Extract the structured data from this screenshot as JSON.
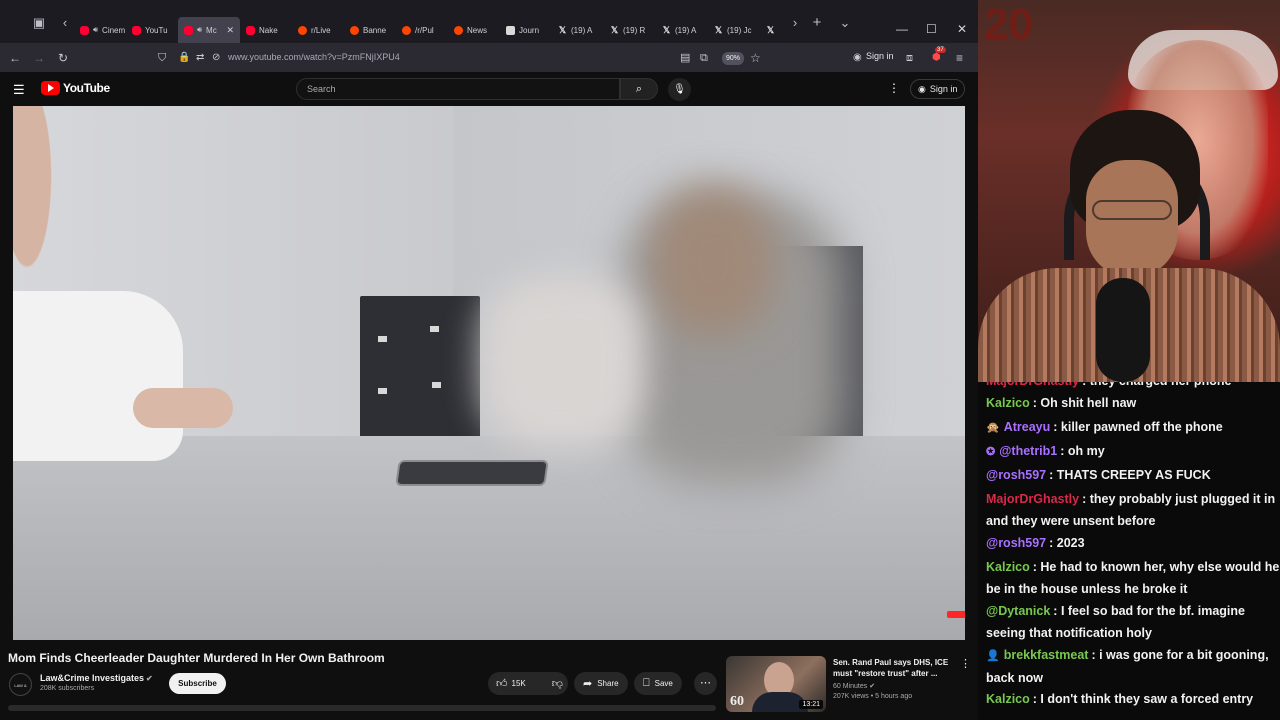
{
  "browser": {
    "tabs": [
      {
        "label": "Cinem",
        "icon": "youtube-icon",
        "audio": true
      },
      {
        "label": "YouTu",
        "icon": "youtube-icon",
        "audio": false
      },
      {
        "label": "Mc",
        "icon": "youtube-icon",
        "audio": true,
        "active": true
      },
      {
        "label": "Nake",
        "icon": "youtube-icon",
        "audio": false
      },
      {
        "label": "r/Live",
        "icon": "reddit-icon",
        "audio": false
      },
      {
        "label": "Banne",
        "icon": "reddit-icon",
        "audio": false
      },
      {
        "label": "/r/Pul",
        "icon": "reddit-icon",
        "audio": false
      },
      {
        "label": "News",
        "icon": "reddit-icon",
        "audio": false
      },
      {
        "label": "Journ",
        "icon": "ap-icon",
        "audio": false
      },
      {
        "label": "(19) A",
        "icon": "x-icon",
        "audio": false
      },
      {
        "label": "(19) R",
        "icon": "x-icon",
        "audio": false
      },
      {
        "label": "(19) A",
        "icon": "x-icon",
        "audio": false
      },
      {
        "label": "(19) Jc",
        "icon": "x-icon",
        "audio": false
      },
      {
        "label": "",
        "icon": "x-icon",
        "audio": false
      }
    ],
    "url": "www.youtube.com/watch?v=PzmFNjIXPU4",
    "zoom": "90%",
    "extension_badge": "37",
    "signin_label": "Sign in"
  },
  "youtube": {
    "logo_text": "YouTube",
    "search_placeholder": "Search",
    "signin_label": "Sign in",
    "video": {
      "title": "Mom Finds Cheerleader Daughter Murdered In Her Own Bathroom",
      "channel": "Law&Crime Investigates",
      "channel_avatar_text": "LAW & CRIME",
      "subscribers": "208K subscribers",
      "subscribe_label": "Subscribe",
      "likes": "15K",
      "share_label": "Share",
      "save_label": "Save"
    },
    "recommended": {
      "title": "Sen. Rand Paul says DHS, ICE must \"restore trust\" after ...",
      "channel": "60 Minutes",
      "views": "207K views",
      "age": "5 hours ago",
      "duration": "13:21",
      "thumb_logo": "60"
    }
  },
  "stream": {
    "overlay_number": "20"
  },
  "chat": {
    "colors": {
      "green": "#78c850",
      "purple": "#a970ff",
      "red": "#d8294a",
      "blue": "#7e9cff",
      "text": "#f2f2f2"
    },
    "messages": [
      {
        "user": "MajorDrGhastly",
        "text": "they charged her phone",
        "color": "#d8294a",
        "badge": "",
        "line2": ""
      },
      {
        "user": "Kalzico",
        "text": "Oh shit hell naw",
        "color": "#78c850",
        "badge": "",
        "line2": ""
      },
      {
        "user": "Atreayu",
        "text": "killer pawned off the phone",
        "color": "#a970ff",
        "badge": "🙊",
        "line2": ""
      },
      {
        "user": "@thetrib1",
        "text": "oh my",
        "color": "#a970ff",
        "badge": "✪",
        "line2": ""
      },
      {
        "user": "@rosh597",
        "text": "THATS CREEPY AS FUCK",
        "color": "#a970ff",
        "badge": "",
        "line2": ""
      },
      {
        "user": "MajorDrGhastly",
        "text": "they probably just plugged it in",
        "color": "#d8294a",
        "badge": "",
        "line2": "and they were unsent before"
      },
      {
        "user": "@rosh597",
        "text": "2023",
        "color": "#a970ff",
        "badge": "",
        "line2": ""
      },
      {
        "user": "Kalzico",
        "text": "He had to known her, why else would he",
        "color": "#78c850",
        "badge": "",
        "line2": "be in the house unless he broke it"
      },
      {
        "user": "@Dytanick",
        "text": "I feel so bad for the bf. imagine",
        "color": "#78c850",
        "badge": "",
        "line2": "seeing that notification holy"
      },
      {
        "user": "brekkfastmeat",
        "text": "i was gone for a bit gooning,",
        "color": "#78c850",
        "badge": "👤",
        "line2": "back now"
      },
      {
        "user": "Kalzico",
        "text": "I don't think they saw a forced entry",
        "color": "#78c850",
        "badge": "",
        "line2": ""
      }
    ]
  }
}
